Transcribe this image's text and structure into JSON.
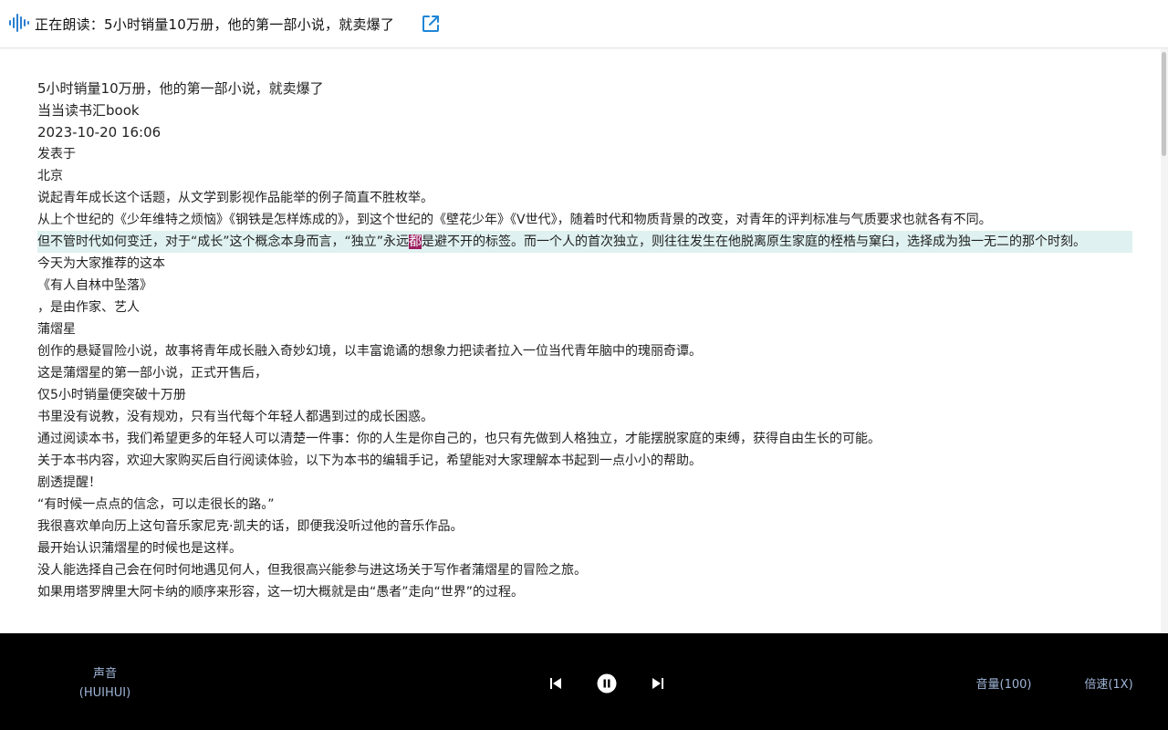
{
  "topbar": {
    "reading_prefix": "正在朗读：",
    "reading_title": "5小时销量10万册，他的第一部小说，就卖爆了"
  },
  "article": {
    "paragraphs": [
      "5小时销量10万册，他的第一部小说，就卖爆了",
      "当当读书汇book",
      "2023-10-20 16:06",
      "发表于",
      "北京",
      "说起青年成长这个话题，从文学到影视作品能举的例子简直不胜枚举。",
      "从上个世纪的《少年维特之烦恼》《钢铁是怎样炼成的》，到这个世纪的《壁花少年》《V世代》，随着时代和物质背景的改变，对青年的评判标准与气质要求也就各有不同。",
      "但不管时代如何变迁，对于“成长”这个概念本身而言，“独立”永远都是避不开的标签。而一个人的首次独立，则往往发生在他脱离原生家庭的桎梏与窠臼，选择成为独一无二的那个时刻。",
      "今天为大家推荐的这本",
      "《有人自林中坠落》",
      "，是由作家、艺人",
      "蒲熠星",
      "创作的悬疑冒险小说，故事将青年成长融入奇妙幻境，以丰富诡谲的想象力把读者拉入一位当代青年脑中的瑰丽奇谭。",
      "这是蒲熠星的第一部小说，正式开售后，",
      "仅5小时销量便突破十万册",
      "书里没有说教，没有规劝，只有当代每个年轻人都遇到过的成长困惑。",
      "通过阅读本书，我们希望更多的年轻人可以清楚一件事：你的人生是你自己的，也只有先做到人格独立，才能摆脱家庭的束缚，获得自由生长的可能。",
      "关于本书内容，欢迎大家购买后自行阅读体验，以下为本书的编辑手记，希望能对大家理解本书起到一点小小的帮助。",
      "剧透提醒！",
      "“有时候一点点的信念，可以走很长的路。”",
      "我很喜欢单向历上这句音乐家尼克·凯夫的话，即便我没听过他的音乐作品。",
      "最开始认识蒲熠星的时候也是这样。",
      "没人能选择自己会在何时何地遇见何人，但我很高兴能参与进这场关于写作者蒲熠星的冒险之旅。",
      "如果用塔罗牌里大阿卡纳的顺序来形容，这一切大概就是由“愚者”走向“世界”的过程。"
    ],
    "highlighted_paragraph_index": 7,
    "highlight_before": "但不管时代如何变迁，对于“成长”这个概念本身而言，“独立”永远",
    "highlight_current_char": "都",
    "highlight_after": "是避不开的标签。而一个人的首次独立，则往往发生在他脱离原生家庭的桎梏与窠臼，选择成为独一无二的那个时刻。"
  },
  "player": {
    "voice_label": "声音",
    "voice_name": "(HUIHUI)",
    "volume_label": "音量(100)",
    "speed_label": "倍速(1X)",
    "prev_icon": "skip-previous-icon",
    "pause_icon": "pause-icon",
    "next_icon": "skip-next-icon"
  },
  "colors": {
    "highlight_bg": "#dff1f0",
    "current_word_bg": "#9b1c5f",
    "player_bg": "#000000",
    "player_text": "#9fb4d6",
    "accent": "#1f86d6"
  }
}
